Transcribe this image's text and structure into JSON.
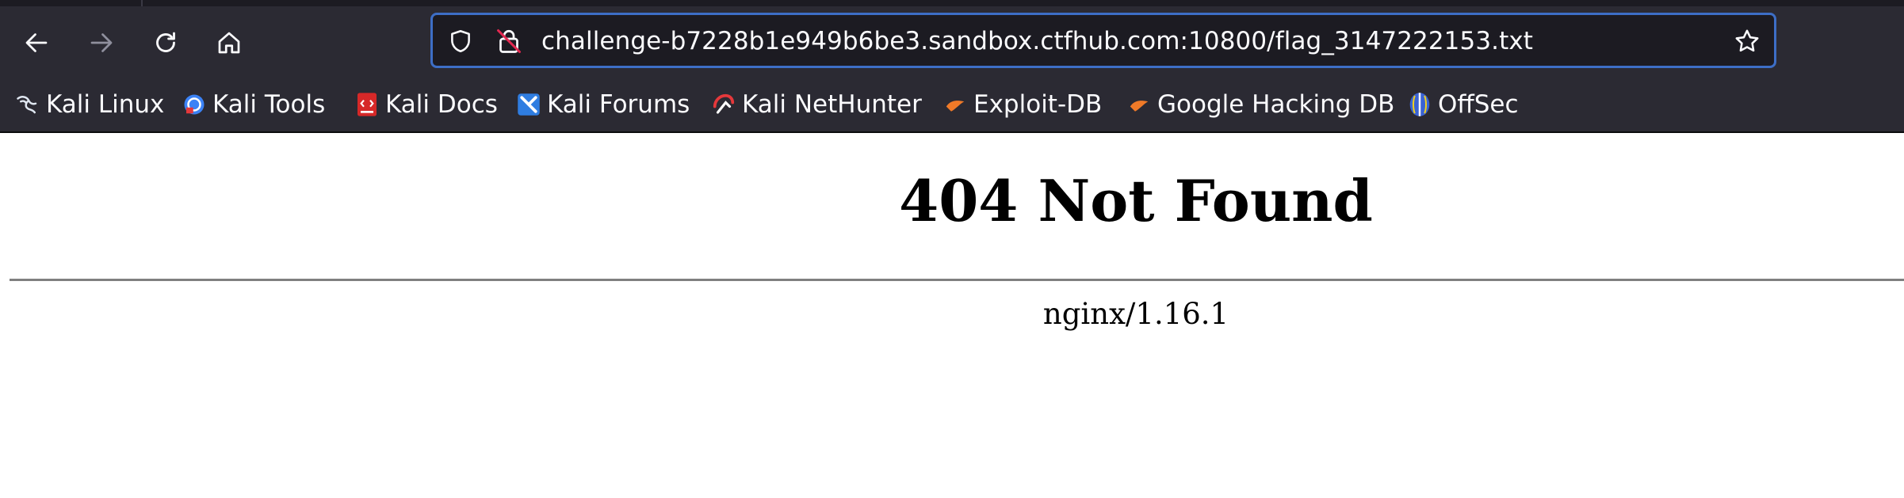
{
  "browser": {
    "url": "challenge-b7228b1e949b6be3.sandbox.ctfhub.com:10800/flag_3147222153.txt",
    "accent_color": "#3d6ec6",
    "toolbar_color": "#2b2a33",
    "nav_icons": [
      "back-arrow-icon",
      "forward-arrow-icon",
      "reload-icon",
      "home-icon"
    ],
    "urlbar_icons": [
      "shield-icon",
      "insecure-lock-icon",
      "bookmark-star-icon"
    ]
  },
  "bookmarks": [
    {
      "label": "Kali Linux",
      "icon": "kali-dragon-icon"
    },
    {
      "label": "Kali Tools",
      "icon": "kali-tools-icon"
    },
    {
      "label": "Kali Docs",
      "icon": "kali-docs-icon"
    },
    {
      "label": "Kali Forums",
      "icon": "kali-forums-icon"
    },
    {
      "label": "Kali NetHunter",
      "icon": "kali-nethunter-icon"
    },
    {
      "label": "Exploit-DB",
      "icon": "exploit-db-icon"
    },
    {
      "label": "Google Hacking DB",
      "icon": "google-hacking-db-icon"
    },
    {
      "label": "OffSec",
      "icon": "offsec-icon"
    }
  ],
  "page": {
    "heading": "404 Not Found",
    "server": "nginx/1.16.1"
  }
}
